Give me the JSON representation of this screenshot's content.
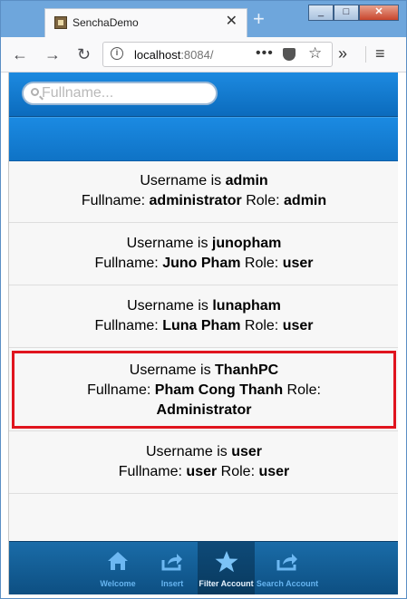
{
  "browser": {
    "tab_title": "SenchaDemo",
    "tab_close": "✕",
    "new_tab": "+",
    "window_buttons": [
      "_",
      "□",
      "✕"
    ],
    "url_host": "localhost",
    "url_port": ":8084/",
    "url_more": "•••"
  },
  "search": {
    "placeholder": "Fullname..."
  },
  "accounts": [
    {
      "prefix": "Username is ",
      "username": "admin",
      "fullname_label": "Fullname: ",
      "fullname": "administrator",
      "role_label": " Role: ",
      "role": "admin"
    },
    {
      "prefix": "Username is ",
      "username": "junopham",
      "fullname_label": "Fullname: ",
      "fullname": "Juno Pham",
      "role_label": " Role: ",
      "role": "user"
    },
    {
      "prefix": "Username is ",
      "username": "lunapham",
      "fullname_label": "Fullname: ",
      "fullname": "Luna Pham",
      "role_label": " Role: ",
      "role": "user"
    },
    {
      "prefix": "Username is ",
      "username": "ThanhPC",
      "fullname_label": "Fullname: ",
      "fullname": "Pham Cong Thanh",
      "role_label": " Role: ",
      "role": "Administrator"
    },
    {
      "prefix": "Username is ",
      "username": "user",
      "fullname_label": "Fullname: ",
      "fullname": "user",
      "role_label": " Role: ",
      "role": "user"
    }
  ],
  "tabbar": {
    "items": [
      {
        "label": "Welcome",
        "icon": "home-icon"
      },
      {
        "label": "Insert",
        "icon": "share-icon"
      },
      {
        "label": "Filter Account",
        "icon": "star-icon",
        "active": true
      },
      {
        "label": "Search Account",
        "icon": "share-icon"
      }
    ]
  },
  "colors": {
    "accent": "#1b8ae2",
    "highlight": "#e0141e",
    "tabbar": "#0d4f82"
  }
}
